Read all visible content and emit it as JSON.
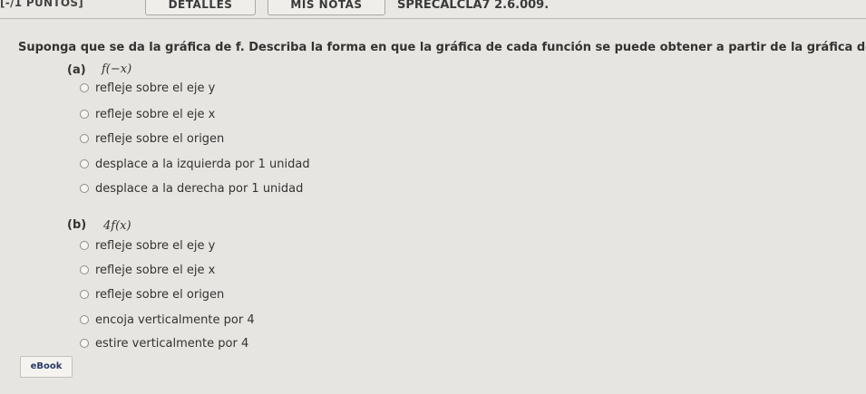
{
  "header": {
    "points": "[-/1 PUNTOS]",
    "tabs": [
      {
        "label": "DETALLES"
      },
      {
        "label": "MIS NOTAS"
      }
    ],
    "problem_id": "SPRECALCLA7 2.6.009."
  },
  "question": {
    "text": "Suponga que se da la gráfica de f. Describa la forma en que la gráfica de cada función se puede obtener a partir de la gráfica de f."
  },
  "parts": [
    {
      "label": "(a)",
      "expression": "f(−x)",
      "options": [
        "refleje sobre el eje y",
        "refleje sobre el eje x",
        "refleje sobre el origen",
        "desplace a la izquierda por 1 unidad",
        "desplace a la derecha por 1 unidad"
      ]
    },
    {
      "label": "(b)",
      "expression": "4f(x)",
      "options": [
        "refleje sobre el eje y",
        "refleje sobre el eje x",
        "refleje sobre el origen",
        "encoja verticalmente por 4",
        "estire verticalmente por 4"
      ]
    }
  ],
  "footer": {
    "ebook_label": "eBook"
  }
}
